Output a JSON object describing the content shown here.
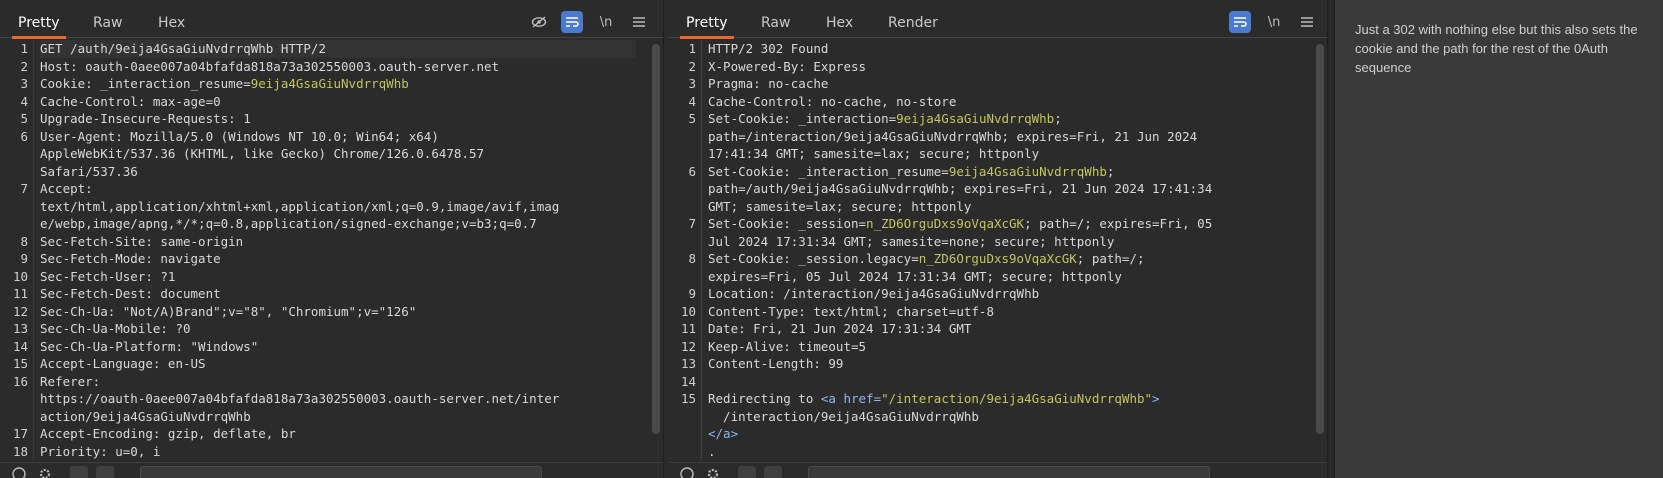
{
  "request": {
    "tabs": [
      {
        "label": "Pretty",
        "active": true
      },
      {
        "label": "Raw",
        "active": false
      },
      {
        "label": "Hex",
        "active": false
      }
    ],
    "toolbar": {
      "newline_label": "\\n",
      "icons": [
        "hide-icon",
        "wrap-icon",
        "newline-icon",
        "menu-icon"
      ]
    },
    "lines": [
      {
        "n": "1",
        "parts": [
          [
            "k",
            "GET /auth/9eija4GsaGiuNvdrrqWhb HTTP/2"
          ]
        ]
      },
      {
        "n": "2",
        "parts": [
          [
            "k",
            "Host: oauth-0aee007a04bfafda818a73a302550003.oauth-server.net"
          ]
        ]
      },
      {
        "n": "3",
        "parts": [
          [
            "k",
            "Cookie: _interaction_resume="
          ],
          [
            "g",
            "9eija4GsaGiuNvdrrqWhb"
          ]
        ]
      },
      {
        "n": "4",
        "parts": [
          [
            "k",
            "Cache-Control: max-age=0"
          ]
        ]
      },
      {
        "n": "5",
        "parts": [
          [
            "k",
            "Upgrade-Insecure-Requests: 1"
          ]
        ]
      },
      {
        "n": "6",
        "parts": [
          [
            "k",
            "User-Agent: Mozilla/5.0 (Windows NT 10.0; Win64; x64)"
          ]
        ]
      },
      {
        "n": "",
        "parts": [
          [
            "k",
            "AppleWebKit/537.36 (KHTML, like Gecko) Chrome/126.0.6478.57"
          ]
        ]
      },
      {
        "n": "",
        "parts": [
          [
            "k",
            "Safari/537.36"
          ]
        ]
      },
      {
        "n": "7",
        "parts": [
          [
            "k",
            "Accept:"
          ]
        ]
      },
      {
        "n": "",
        "parts": [
          [
            "k",
            "text/html,application/xhtml+xml,application/xml;q=0.9,image/avif,imag"
          ]
        ]
      },
      {
        "n": "",
        "parts": [
          [
            "k",
            "e/webp,image/apng,*/*;q=0.8,application/signed-exchange;v=b3;q=0.7"
          ]
        ]
      },
      {
        "n": "8",
        "parts": [
          [
            "k",
            "Sec-Fetch-Site: same-origin"
          ]
        ]
      },
      {
        "n": "9",
        "parts": [
          [
            "k",
            "Sec-Fetch-Mode: navigate"
          ]
        ]
      },
      {
        "n": "10",
        "parts": [
          [
            "k",
            "Sec-Fetch-User: ?1"
          ]
        ]
      },
      {
        "n": "11",
        "parts": [
          [
            "k",
            "Sec-Fetch-Dest: document"
          ]
        ]
      },
      {
        "n": "12",
        "parts": [
          [
            "k",
            "Sec-Ch-Ua: \"Not/A)Brand\";v=\"8\", \"Chromium\";v=\"126\""
          ]
        ]
      },
      {
        "n": "13",
        "parts": [
          [
            "k",
            "Sec-Ch-Ua-Mobile: ?0"
          ]
        ]
      },
      {
        "n": "14",
        "parts": [
          [
            "k",
            "Sec-Ch-Ua-Platform: \"Windows\""
          ]
        ]
      },
      {
        "n": "15",
        "parts": [
          [
            "k",
            "Accept-Language: en-US"
          ]
        ]
      },
      {
        "n": "16",
        "parts": [
          [
            "k",
            "Referer:"
          ]
        ]
      },
      {
        "n": "",
        "parts": [
          [
            "k",
            "https://oauth-0aee007a04bfafda818a73a302550003.oauth-server.net/inter"
          ]
        ]
      },
      {
        "n": "",
        "parts": [
          [
            "k",
            "action/9eija4GsaGiuNvdrrqWhb"
          ]
        ]
      },
      {
        "n": "17",
        "parts": [
          [
            "k",
            "Accept-Encoding: gzip, deflate, br"
          ]
        ]
      },
      {
        "n": "18",
        "parts": [
          [
            "k",
            "Priority: u=0, i"
          ]
        ]
      }
    ]
  },
  "response": {
    "tabs": [
      {
        "label": "Pretty",
        "active": true
      },
      {
        "label": "Raw",
        "active": false
      },
      {
        "label": "Hex",
        "active": false
      },
      {
        "label": "Render",
        "active": false
      }
    ],
    "toolbar": {
      "newline_label": "\\n",
      "icons": [
        "wrap-icon",
        "newline-icon",
        "menu-icon"
      ]
    },
    "lines": [
      {
        "n": "1",
        "parts": [
          [
            "k",
            "HTTP/2 302 Found"
          ]
        ]
      },
      {
        "n": "2",
        "parts": [
          [
            "k",
            "X-Powered-By: Express"
          ]
        ]
      },
      {
        "n": "3",
        "parts": [
          [
            "k",
            "Pragma: no-cache"
          ]
        ]
      },
      {
        "n": "4",
        "parts": [
          [
            "k",
            "Cache-Control: no-cache, no-store"
          ]
        ]
      },
      {
        "n": "5",
        "parts": [
          [
            "k",
            "Set-Cookie: _interaction="
          ],
          [
            "g",
            "9eija4GsaGiuNvdrrqWhb"
          ],
          [
            "k",
            ";"
          ]
        ]
      },
      {
        "n": "",
        "parts": [
          [
            "k",
            "path=/interaction/9eija4GsaGiuNvdrrqWhb; expires=Fri, 21 Jun 2024"
          ]
        ]
      },
      {
        "n": "",
        "parts": [
          [
            "k",
            "17:41:34 GMT; samesite=lax; secure; httponly"
          ]
        ]
      },
      {
        "n": "6",
        "parts": [
          [
            "k",
            "Set-Cookie: _interaction_resume="
          ],
          [
            "g",
            "9eija4GsaGiuNvdrrqWhb"
          ],
          [
            "k",
            ";"
          ]
        ]
      },
      {
        "n": "",
        "parts": [
          [
            "k",
            "path=/auth/9eija4GsaGiuNvdrrqWhb; expires=Fri, 21 Jun 2024 17:41:34"
          ]
        ]
      },
      {
        "n": "",
        "parts": [
          [
            "k",
            "GMT; samesite=lax; secure; httponly"
          ]
        ]
      },
      {
        "n": "7",
        "parts": [
          [
            "k",
            "Set-Cookie: _session="
          ],
          [
            "g",
            "n_ZD6OrguDxs9oVqaXcGK"
          ],
          [
            "k",
            "; path=/; expires=Fri, 05"
          ]
        ]
      },
      {
        "n": "",
        "parts": [
          [
            "k",
            "Jul 2024 17:31:34 GMT; samesite=none; secure; httponly"
          ]
        ]
      },
      {
        "n": "8",
        "parts": [
          [
            "k",
            "Set-Cookie: _session.legacy="
          ],
          [
            "g",
            "n_ZD6OrguDxs9oVqaXcGK"
          ],
          [
            "k",
            "; path=/;"
          ]
        ]
      },
      {
        "n": "",
        "parts": [
          [
            "k",
            "expires=Fri, 05 Jul 2024 17:31:34 GMT; secure; httponly"
          ]
        ]
      },
      {
        "n": "9",
        "parts": [
          [
            "k",
            "Location: /interaction/9eija4GsaGiuNvdrrqWhb"
          ]
        ]
      },
      {
        "n": "10",
        "parts": [
          [
            "k",
            "Content-Type: text/html; charset=utf-8"
          ]
        ]
      },
      {
        "n": "11",
        "parts": [
          [
            "k",
            "Date: Fri, 21 Jun 2024 17:31:34 GMT"
          ]
        ]
      },
      {
        "n": "12",
        "parts": [
          [
            "k",
            "Keep-Alive: timeout=5"
          ]
        ]
      },
      {
        "n": "13",
        "parts": [
          [
            "k",
            "Content-Length: 99"
          ]
        ]
      },
      {
        "n": "14",
        "parts": [
          [
            "k",
            ""
          ]
        ]
      },
      {
        "n": "15",
        "parts": [
          [
            "k",
            "Redirecting to "
          ],
          [
            "b",
            "<a href="
          ],
          [
            "g",
            "\"/interaction/9eija4GsaGiuNvdrrqWhb\""
          ],
          [
            "b",
            ">"
          ]
        ]
      },
      {
        "n": "",
        "parts": [
          [
            "k",
            "  /interaction/9eija4GsaGiuNvdrrqWhb"
          ]
        ]
      },
      {
        "n": "",
        "parts": [
          [
            "b",
            "</a>"
          ]
        ]
      },
      {
        "n": "",
        "parts": [
          [
            "k",
            "."
          ]
        ]
      }
    ]
  },
  "notes": {
    "text": "Just a 302 with nothing else but this also sets the cookie and the path for the rest of the 0Auth sequence"
  },
  "colors": {
    "accent_tab": "#e8692e",
    "toggle_on": "#4a7bd0",
    "string_green": "#c2c65a",
    "tag_blue": "#8fb6ee"
  }
}
